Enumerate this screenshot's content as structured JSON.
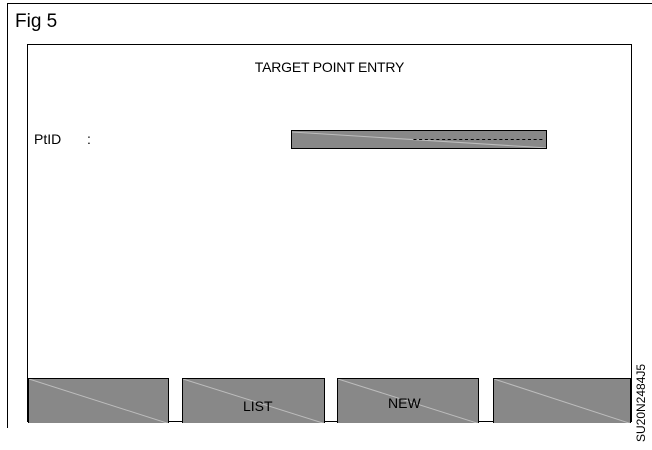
{
  "figure": {
    "label": "Fig 5",
    "side_code": "SU20N2484J5"
  },
  "screen": {
    "title": "TARGET POINT ENTRY",
    "ptid_field": {
      "label": "PtID",
      "separator": ":",
      "value": "-----------------------"
    }
  },
  "softkeys": {
    "f1": "",
    "f2": "LIST",
    "f3": "NEW",
    "f4": ""
  },
  "colors": {
    "key_fill": "#888888",
    "diagonal": "#bdbdbd"
  }
}
